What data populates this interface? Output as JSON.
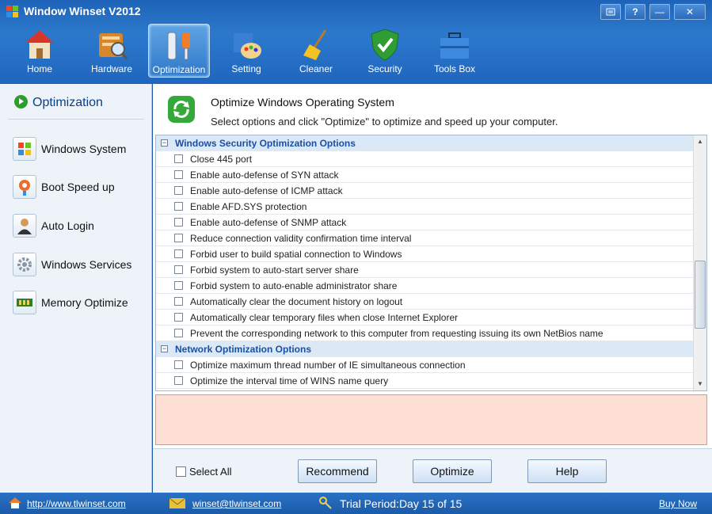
{
  "app": {
    "title": "Window Winset V2012"
  },
  "window_buttons": [
    "restore-icon",
    "help-icon",
    "minimize-icon",
    "close-icon"
  ],
  "window_glyphs": {
    "help": "?",
    "minimize": "—",
    "close": "✕"
  },
  "nav": [
    {
      "label": "Home",
      "icon": "home-icon"
    },
    {
      "label": "Hardware",
      "icon": "hardware-icon"
    },
    {
      "label": "Optimization",
      "icon": "tools-icon",
      "active": true
    },
    {
      "label": "Setting",
      "icon": "paint-icon"
    },
    {
      "label": "Cleaner",
      "icon": "broom-icon"
    },
    {
      "label": "Security",
      "icon": "shield-icon"
    },
    {
      "label": "Tools Box",
      "icon": "toolbox-icon"
    }
  ],
  "sidebar": {
    "heading": "Optimization",
    "items": [
      {
        "label": "Windows System",
        "icon": "windows-icon"
      },
      {
        "label": "Boot Speed up",
        "icon": "rocket-icon"
      },
      {
        "label": "Auto Login",
        "icon": "user-icon"
      },
      {
        "label": "Windows Services",
        "icon": "gear-icon"
      },
      {
        "label": "Memory Optimize",
        "icon": "memory-icon"
      }
    ]
  },
  "header": {
    "title": "Optimize Windows Operating System",
    "subtitle": "Select options and click \"Optimize\" to optimize and speed up your computer."
  },
  "groups": [
    {
      "title": "Windows Security Optimization Options",
      "items": [
        "Close 445 port",
        "Enable auto-defense of SYN attack",
        "Enable auto-defense of ICMP attack",
        "Enable AFD.SYS protection",
        "Enable auto-defense of SNMP attack",
        "Reduce connection validity confirmation time interval",
        "Forbid user to build spatial connection to Windows",
        "Forbid system to auto-start server share",
        "Forbid system to auto-enable administrator share",
        "Automatically clear the document history on logout",
        "Automatically clear temporary files when close Internet Explorer",
        "Prevent the corresponding network to this computer from requesting issuing its own NetBios name"
      ]
    },
    {
      "title": "Network Optimization Options",
      "items": [
        "Optimize maximum thread number of IE simultaneous connection",
        "Optimize the interval time of WINS name query"
      ]
    }
  ],
  "buttons": {
    "select_all": "Select All",
    "recommend": "Recommend",
    "optimize": "Optimize",
    "help": "Help"
  },
  "status": {
    "website": "http://www.tlwinset.com",
    "email": "winset@tlwinset.com",
    "trial": "Trial Period:Day 15 of 15",
    "buy": "Buy Now"
  },
  "colors": {
    "accent": "#1f66be",
    "group_text": "#1a4fa6",
    "desc_bg": "#fde0d3"
  }
}
